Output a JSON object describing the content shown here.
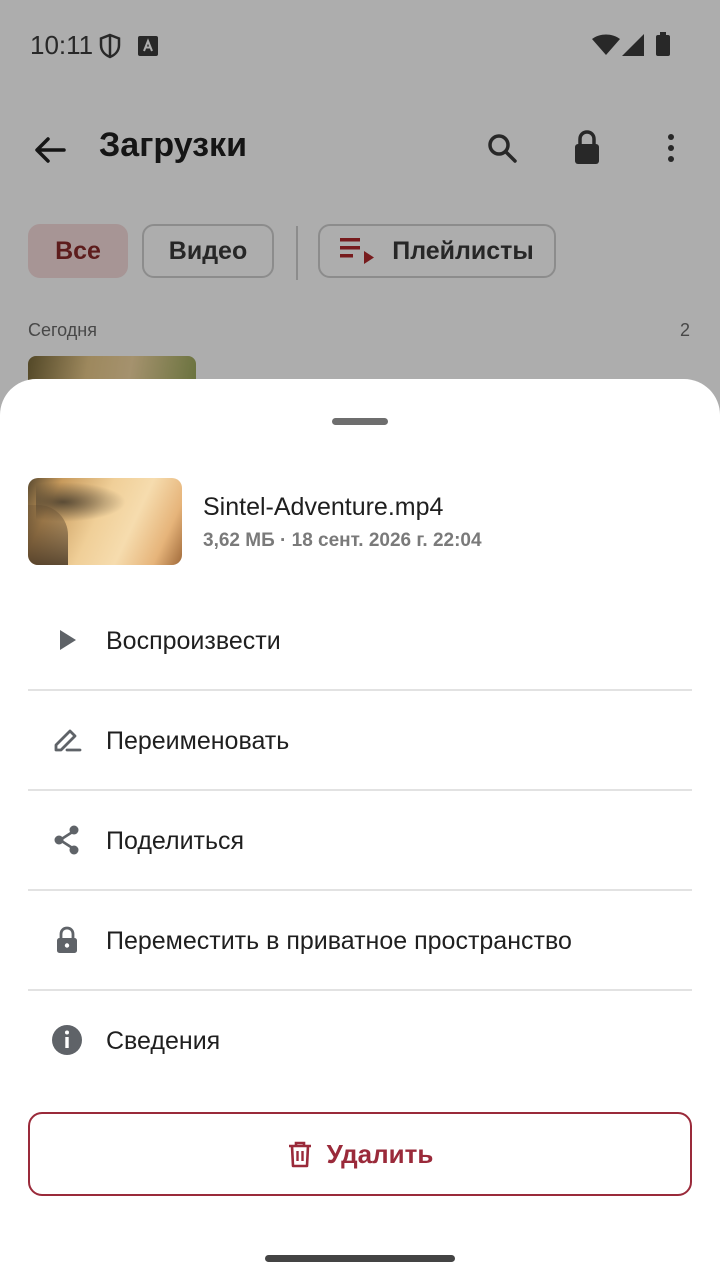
{
  "status_bar": {
    "time": "10:11"
  },
  "app_bar": {
    "title": "Загрузки"
  },
  "chips": {
    "all": "Все",
    "video": "Видео",
    "playlists": "Плейлисты"
  },
  "section": {
    "label": "Сегодня",
    "count": "2"
  },
  "sheet": {
    "file_name": "Sintel-Adventure.mp4",
    "file_meta": "3,62 МБ · 18 сент. 2026 г. 22:04",
    "items": [
      {
        "label": "Воспроизвести",
        "icon": "play-icon"
      },
      {
        "label": "Переименовать",
        "icon": "edit-icon"
      },
      {
        "label": "Поделиться",
        "icon": "share-icon"
      },
      {
        "label": "Переместить в приватное пространство",
        "icon": "lock-icon"
      },
      {
        "label": "Сведения",
        "icon": "info-icon"
      }
    ],
    "delete_label": "Удалить"
  },
  "colors": {
    "accent": "#9a2a3a",
    "chip_active_bg": "#f6dcdc",
    "icon": "#5f6368"
  }
}
